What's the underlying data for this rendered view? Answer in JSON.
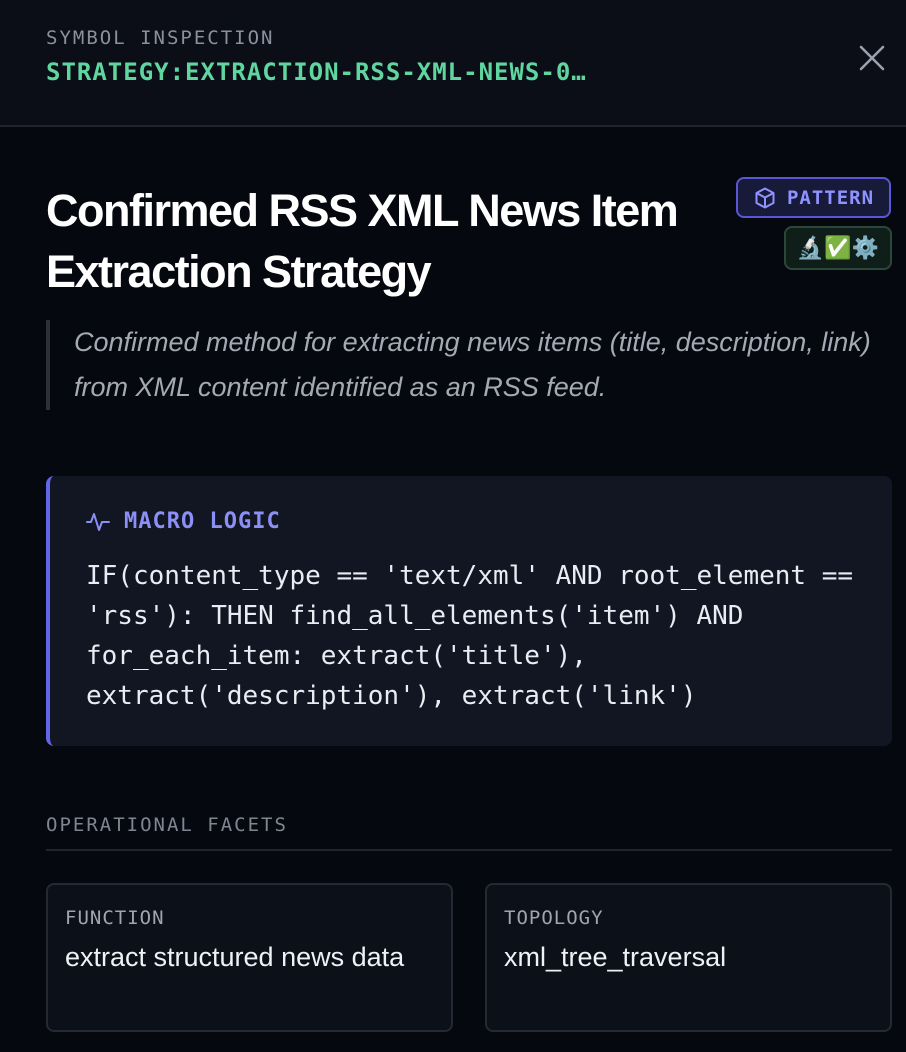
{
  "header": {
    "eyebrow": "SYMBOL INSPECTION",
    "symbol_id": "STRATEGY:EXTRACTION-RSS-XML-NEWS-0…",
    "close_icon": "close-icon"
  },
  "symbol": {
    "title": "Confirmed RSS XML News Item Extraction Strategy",
    "kind_badge": {
      "icon": "cube-icon",
      "label": "PATTERN"
    },
    "status_emojis": "🔬✅⚙️",
    "description": "Confirmed method for extracting news items (title, description, link) from XML content identified as an RSS feed."
  },
  "macro": {
    "icon": "pulse-icon",
    "label": "MACRO LOGIC",
    "code": "IF(content_type == 'text/xml' AND root_element == 'rss'): THEN find_all_elements('item') AND for_each_item: extract('title'), extract('description'), extract('link')"
  },
  "facets": {
    "title": "OPERATIONAL FACETS",
    "items": [
      {
        "key": "FUNCTION",
        "value": "extract structured news data"
      },
      {
        "key": "TOPOLOGY",
        "value": "xml_tree_traversal"
      }
    ]
  },
  "colors": {
    "background": "#060810",
    "header_bg": "#0b0e16",
    "accent_green": "#5fd6a0",
    "accent_indigo": "#6466e8",
    "badge_text": "#8f93ff"
  }
}
